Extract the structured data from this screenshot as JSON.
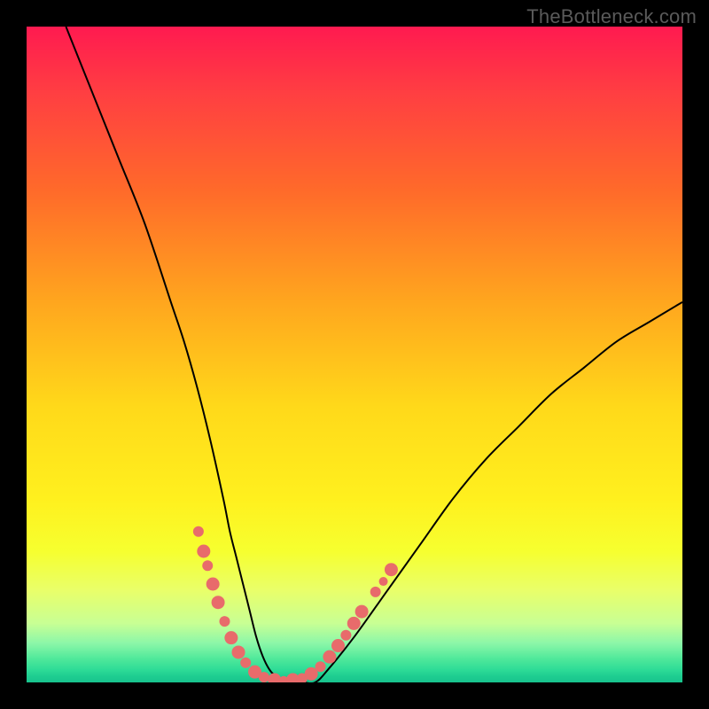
{
  "watermark": "TheBottleneck.com",
  "chart_data": {
    "type": "line",
    "title": "",
    "xlabel": "",
    "ylabel": "",
    "xlim": [
      0,
      100
    ],
    "ylim": [
      0,
      100
    ],
    "grid": false,
    "legend": false,
    "series": [
      {
        "name": "curve",
        "color": "#000000",
        "x": [
          6,
          10,
          14,
          18,
          22,
          24,
          26,
          28,
          30,
          31,
          32,
          33,
          34,
          35,
          36,
          37,
          38,
          40,
          42,
          44,
          46,
          50,
          55,
          60,
          65,
          70,
          75,
          80,
          85,
          90,
          95,
          100
        ],
        "y": [
          100,
          90,
          80,
          70,
          58,
          52,
          45,
          37,
          28,
          23,
          19,
          15,
          11,
          7,
          4,
          2,
          1,
          0,
          0,
          0,
          2,
          7,
          14,
          21,
          28,
          34,
          39,
          44,
          48,
          52,
          55,
          58
        ]
      }
    ],
    "markers": {
      "color": "#e86b6b",
      "points": [
        {
          "x": 26.2,
          "y": 23.0,
          "size": "med"
        },
        {
          "x": 27.0,
          "y": 20.0,
          "size": "big"
        },
        {
          "x": 27.6,
          "y": 17.8,
          "size": "med"
        },
        {
          "x": 28.4,
          "y": 15.0,
          "size": "big"
        },
        {
          "x": 29.2,
          "y": 12.2,
          "size": "big"
        },
        {
          "x": 30.2,
          "y": 9.3,
          "size": "med"
        },
        {
          "x": 31.2,
          "y": 6.8,
          "size": "big"
        },
        {
          "x": 32.3,
          "y": 4.6,
          "size": "big"
        },
        {
          "x": 33.4,
          "y": 3.0,
          "size": "med"
        },
        {
          "x": 34.8,
          "y": 1.6,
          "size": "big"
        },
        {
          "x": 36.2,
          "y": 0.8,
          "size": "med"
        },
        {
          "x": 37.8,
          "y": 0.4,
          "size": "big"
        },
        {
          "x": 39.2,
          "y": 0.3,
          "size": "sm"
        },
        {
          "x": 40.6,
          "y": 0.4,
          "size": "big"
        },
        {
          "x": 42.0,
          "y": 0.6,
          "size": "med"
        },
        {
          "x": 43.4,
          "y": 1.3,
          "size": "big"
        },
        {
          "x": 44.8,
          "y": 2.4,
          "size": "med"
        },
        {
          "x": 46.2,
          "y": 3.9,
          "size": "big"
        },
        {
          "x": 47.5,
          "y": 5.6,
          "size": "big"
        },
        {
          "x": 48.7,
          "y": 7.2,
          "size": "med"
        },
        {
          "x": 49.9,
          "y": 9.0,
          "size": "big"
        },
        {
          "x": 51.1,
          "y": 10.8,
          "size": "big"
        },
        {
          "x": 53.2,
          "y": 13.8,
          "size": "med"
        },
        {
          "x": 54.4,
          "y": 15.4,
          "size": "sm"
        },
        {
          "x": 55.6,
          "y": 17.2,
          "size": "big"
        }
      ]
    }
  }
}
